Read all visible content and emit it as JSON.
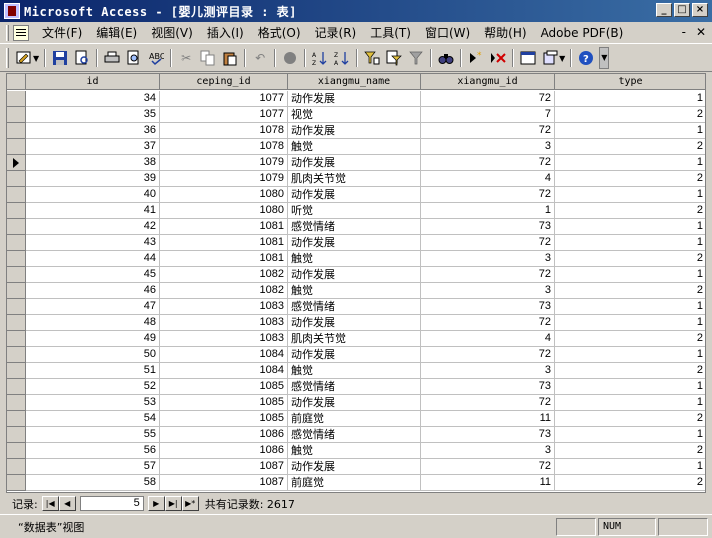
{
  "window": {
    "title": "Microsoft Access - [婴儿测评目录 : 表]",
    "controls": [
      "_",
      "□",
      "×"
    ]
  },
  "menubar": {
    "items": [
      "文件(F)",
      "编辑(E)",
      "视图(V)",
      "插入(I)",
      "格式(O)",
      "记录(R)",
      "工具(T)",
      "窗口(W)",
      "帮助(H)",
      "Adobe PDF(B)"
    ],
    "right": [
      "-",
      "✕"
    ]
  },
  "toolbar": {
    "icons": [
      "view-icon",
      "save-icon",
      "print-icon",
      "print-preview-icon",
      "spelling-icon",
      "cut-icon",
      "copy-icon",
      "paste-icon",
      "undo-icon",
      "insert-hyperlink-icon",
      "sort-ascending-icon",
      "sort-descending-icon",
      "filter-by-selection-icon",
      "filter-by-form-icon",
      "apply-filter-icon",
      "find-icon",
      "new-record-icon",
      "delete-record-icon",
      "database-window-icon",
      "new-object-icon",
      "help-icon"
    ]
  },
  "table": {
    "columns": [
      "id",
      "ceping_id",
      "xiangmu_name",
      "xiangmu_id",
      "type"
    ],
    "current_row_index": 4,
    "rows": [
      [
        "34",
        "1077",
        "动作发展",
        "72",
        "1"
      ],
      [
        "35",
        "1077",
        "视觉",
        "7",
        "2"
      ],
      [
        "36",
        "1078",
        "动作发展",
        "72",
        "1"
      ],
      [
        "37",
        "1078",
        "触觉",
        "3",
        "2"
      ],
      [
        "38",
        "1079",
        "动作发展",
        "72",
        "1"
      ],
      [
        "39",
        "1079",
        "肌肉关节觉",
        "4",
        "2"
      ],
      [
        "40",
        "1080",
        "动作发展",
        "72",
        "1"
      ],
      [
        "41",
        "1080",
        "听觉",
        "1",
        "2"
      ],
      [
        "42",
        "1081",
        "感觉情绪",
        "73",
        "1"
      ],
      [
        "43",
        "1081",
        "动作发展",
        "72",
        "1"
      ],
      [
        "44",
        "1081",
        "触觉",
        "3",
        "2"
      ],
      [
        "45",
        "1082",
        "动作发展",
        "72",
        "1"
      ],
      [
        "46",
        "1082",
        "触觉",
        "3",
        "2"
      ],
      [
        "47",
        "1083",
        "感觉情绪",
        "73",
        "1"
      ],
      [
        "48",
        "1083",
        "动作发展",
        "72",
        "1"
      ],
      [
        "49",
        "1083",
        "肌肉关节觉",
        "4",
        "2"
      ],
      [
        "50",
        "1084",
        "动作发展",
        "72",
        "1"
      ],
      [
        "51",
        "1084",
        "触觉",
        "3",
        "2"
      ],
      [
        "52",
        "1085",
        "感觉情绪",
        "73",
        "1"
      ],
      [
        "53",
        "1085",
        "动作发展",
        "72",
        "1"
      ],
      [
        "54",
        "1085",
        "前庭觉",
        "11",
        "2"
      ],
      [
        "55",
        "1086",
        "感觉情绪",
        "73",
        "1"
      ],
      [
        "56",
        "1086",
        "触觉",
        "3",
        "2"
      ],
      [
        "57",
        "1087",
        "动作发展",
        "72",
        "1"
      ],
      [
        "58",
        "1087",
        "前庭觉",
        "11",
        "2"
      ]
    ]
  },
  "navigator": {
    "label": "记录:",
    "current": "5",
    "total_label": "共有记录数: 2617",
    "buttons": [
      "|◀",
      "◀",
      "▶",
      "▶|",
      "▶*"
    ]
  },
  "status": {
    "text": "“数据表”视图",
    "num": "NUM"
  }
}
